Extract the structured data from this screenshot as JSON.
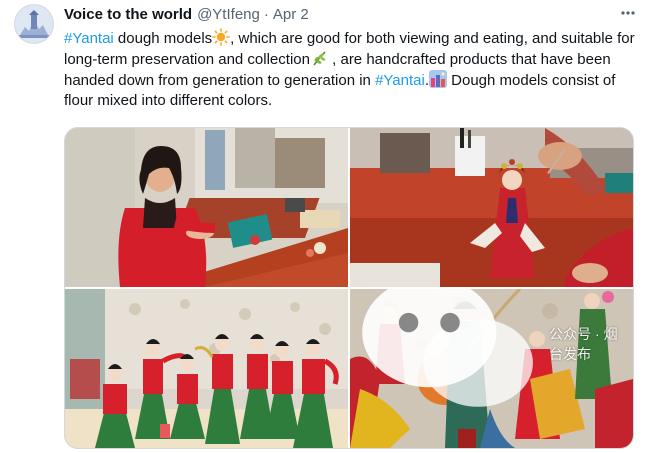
{
  "tweet": {
    "author_name": "Voice to the world",
    "handle": "@YtIfeng",
    "separator": "·",
    "date": "Apr 2",
    "more_icon": "more-icon",
    "text": {
      "hashtag_1": "#Yantai",
      "part_1": " dough models",
      "part_2": ", which are good for both viewing and eating, and suitable for long-term preservation and collection",
      "part_3": " , are handcrafted products that have been handed down from generation to generation in ",
      "hashtag_2": "#Yantai",
      "part_4": ".",
      "part_5": " Dough models consist of flour mixed into different colors."
    },
    "emojis": [
      "sun-emoji",
      "herb-emoji",
      "cityscape-emoji"
    ]
  },
  "media": {
    "photos": [
      {
        "subject": "woman-crafting-photo"
      },
      {
        "subject": "opera-figurine-closeup-photo"
      },
      {
        "subject": "dancing-figurines-photo"
      },
      {
        "subject": "opera-figurines-group-photo"
      }
    ],
    "watermark": "公众号 · 烟台发布"
  },
  "colors": {
    "hashtag": "#1d9bf0",
    "secondary_text": "#536471",
    "primary_text": "#0f1419"
  }
}
